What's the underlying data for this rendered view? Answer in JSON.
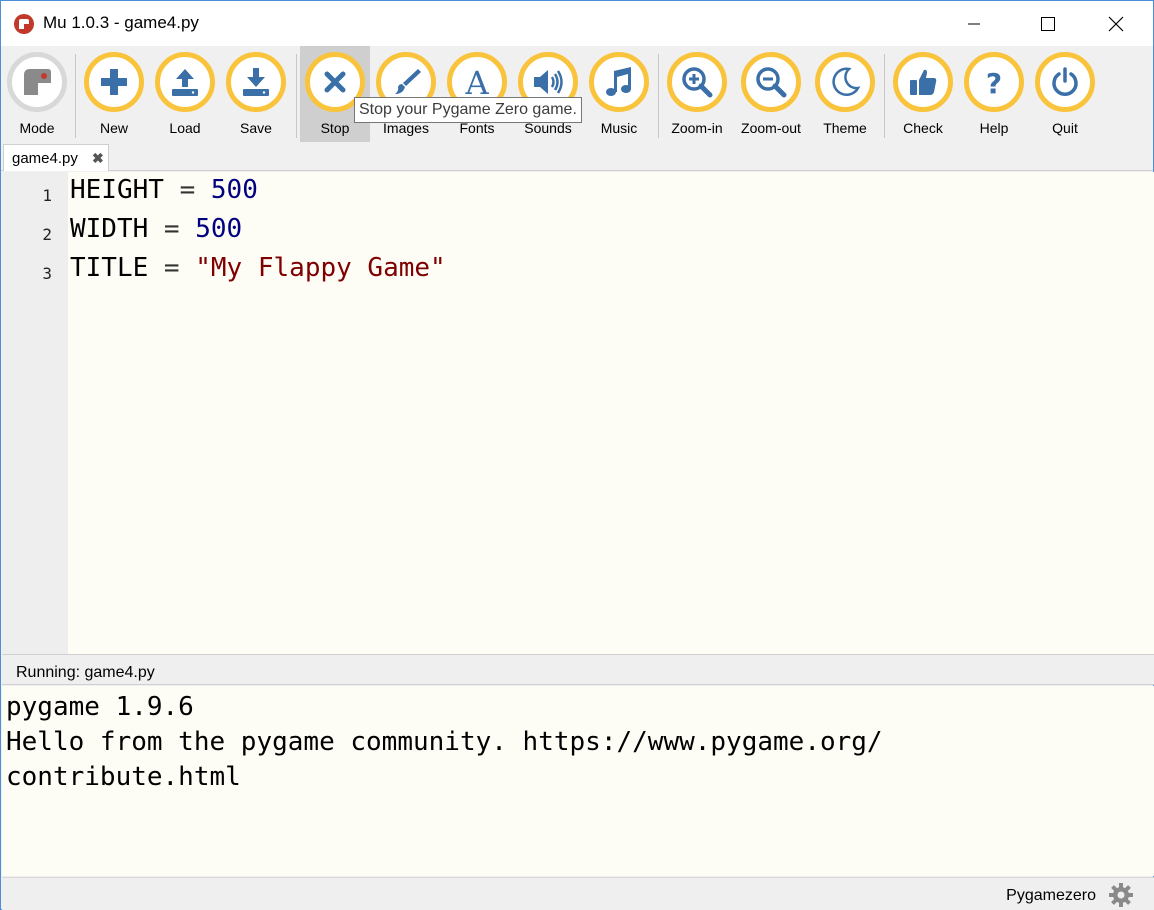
{
  "window": {
    "title": "Mu 1.0.3 - game4.py"
  },
  "toolbar": {
    "buttons": [
      {
        "label": "Mode",
        "icon": "mode-icon"
      },
      {
        "label": "New",
        "icon": "plus-icon"
      },
      {
        "label": "Load",
        "icon": "upload-icon"
      },
      {
        "label": "Save",
        "icon": "download-icon"
      },
      {
        "label": "Stop",
        "icon": "close-x-icon"
      },
      {
        "label": "Images",
        "icon": "brush-icon"
      },
      {
        "label": "Fonts",
        "icon": "font-icon"
      },
      {
        "label": "Sounds",
        "icon": "speaker-icon"
      },
      {
        "label": "Music",
        "icon": "music-note-icon"
      },
      {
        "label": "Zoom-in",
        "icon": "zoom-in-icon"
      },
      {
        "label": "Zoom-out",
        "icon": "zoom-out-icon"
      },
      {
        "label": "Theme",
        "icon": "moon-icon"
      },
      {
        "label": "Check",
        "icon": "thumbs-up-icon"
      },
      {
        "label": "Help",
        "icon": "question-icon"
      },
      {
        "label": "Quit",
        "icon": "power-icon"
      }
    ],
    "tooltip": "Stop your Pygame Zero game."
  },
  "tabs": [
    {
      "label": "game4.py",
      "close": "✖"
    }
  ],
  "editor": {
    "lines": [
      {
        "number": "1",
        "tokens": [
          {
            "t": "HEIGHT",
            "k": "name"
          },
          {
            "t": " = ",
            "k": "op"
          },
          {
            "t": "500",
            "k": "num"
          }
        ]
      },
      {
        "number": "2",
        "tokens": [
          {
            "t": "WIDTH",
            "k": "name"
          },
          {
            "t": " = ",
            "k": "op"
          },
          {
            "t": "500",
            "k": "num"
          }
        ]
      },
      {
        "number": "3",
        "tokens": [
          {
            "t": "TITLE",
            "k": "name"
          },
          {
            "t": " = ",
            "k": "op"
          },
          {
            "t": "\"My Flappy Game\"",
            "k": "str"
          }
        ]
      }
    ]
  },
  "runner": {
    "title": "Running: game4.py",
    "output_lines": [
      "pygame 1.9.6",
      "Hello from the pygame community. https://www.pygame.org/",
      "contribute.html"
    ]
  },
  "status": {
    "mode": "Pygamezero"
  },
  "colors": {
    "accent_ring": "#f9c43c",
    "icon_blue": "#3a6fa8",
    "number": "#000080",
    "string": "#7f0000",
    "editor_bg": "#fefdf5"
  }
}
